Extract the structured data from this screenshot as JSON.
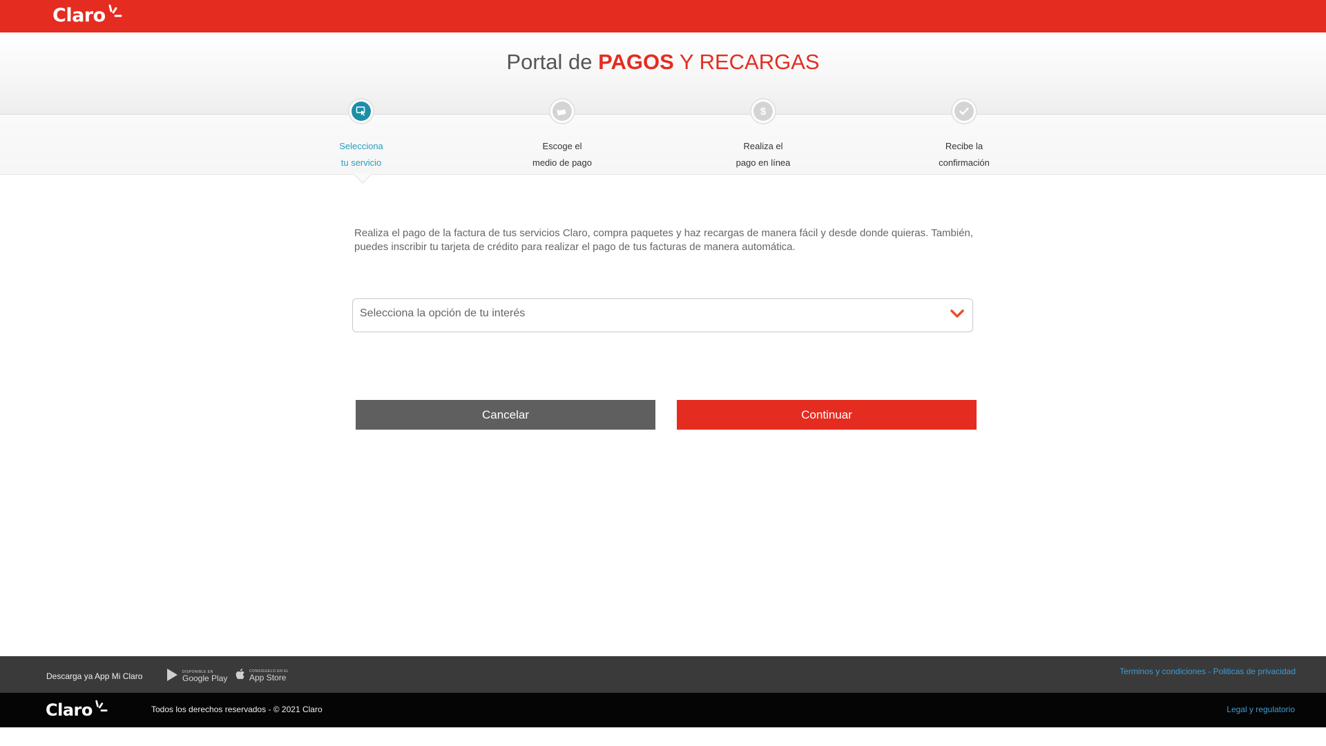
{
  "header": {
    "logo_text": "Claro"
  },
  "hero": {
    "title_prefix": "Portal de",
    "title_strong": "PAGOS",
    "title_suffix": "Y RECARGAS"
  },
  "steps": [
    {
      "line1": "Selecciona",
      "line2": "tu servicio",
      "icon": "cursor-screen-icon",
      "active": true
    },
    {
      "line1": "Escoge el",
      "line2": "medio de pago",
      "icon": "card-icon",
      "active": false
    },
    {
      "line1": "Realiza el",
      "line2": "pago en línea",
      "icon": "dollar-icon",
      "active": false
    },
    {
      "line1": "Recibe la",
      "line2": "confirmación",
      "icon": "checkmark-icon",
      "active": false
    }
  ],
  "main": {
    "description": "Realiza el pago de la factura de tus servicios Claro, compra paquetes y haz recargas de manera fácil y desde donde quieras. También, puedes inscribir tu tarjeta de crédito para realizar el pago de tus facturas de manera automática.",
    "select_placeholder": "Selecciona la opción de tu interés",
    "cancel_label": "Cancelar",
    "continue_label": "Continuar"
  },
  "footer": {
    "download_text": "Descarga ya App Mi Claro",
    "google_small": "DISPONIBLE EN",
    "google_big": "Google Play",
    "apple_small": "CONSÍGUELO EN EL",
    "apple_big": "App Store",
    "terms": "Terminos y condiciones - Politicas de privacidad",
    "rights": "Todos los derechos reservados - © 2021 Claro",
    "legal": "Legal y regulatorio",
    "logo_text": "Claro"
  },
  "colors": {
    "brand_red": "#e52c20",
    "active_teal": "#1b8fa8",
    "footer_dark": "#3a3a3a"
  }
}
